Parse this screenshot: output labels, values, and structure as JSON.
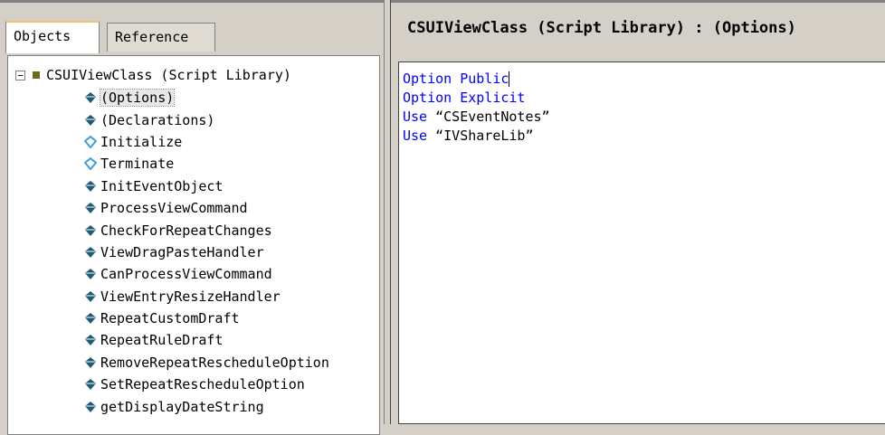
{
  "tabs": {
    "objects": "Objects",
    "reference": "Reference"
  },
  "tree": {
    "root_label": "CSUIViewClass (Script Library)",
    "items": [
      {
        "label": "(Options)",
        "icon": "method-icon"
      },
      {
        "label": "(Declarations)",
        "icon": "method-icon"
      },
      {
        "label": "Initialize",
        "icon": "event-icon"
      },
      {
        "label": "Terminate",
        "icon": "event-icon"
      },
      {
        "label": "InitEventObject",
        "icon": "method-icon"
      },
      {
        "label": "ProcessViewCommand",
        "icon": "method-icon"
      },
      {
        "label": "CheckForRepeatChanges",
        "icon": "method-icon"
      },
      {
        "label": "ViewDragPasteHandler",
        "icon": "method-icon"
      },
      {
        "label": "CanProcessViewCommand",
        "icon": "method-icon"
      },
      {
        "label": "ViewEntryResizeHandler",
        "icon": "method-icon"
      },
      {
        "label": "RepeatCustomDraft",
        "icon": "method-icon"
      },
      {
        "label": "RepeatRuleDraft",
        "icon": "method-icon"
      },
      {
        "label": "RemoveRepeatRescheduleOption",
        "icon": "method-icon"
      },
      {
        "label": "SetRepeatRescheduleOption",
        "icon": "method-icon"
      },
      {
        "label": "getDisplayDateString",
        "icon": "method-icon"
      }
    ]
  },
  "editor": {
    "title": "CSUIViewClass (Script Library) : (Options)",
    "lines": [
      {
        "kw": "Option Public",
        "rest": ""
      },
      {
        "kw": "Option Explicit",
        "rest": ""
      },
      {
        "kw": "Use",
        "rest": " “CSEventNotes”"
      },
      {
        "kw": "Use",
        "rest": " “IVShareLib”"
      }
    ]
  },
  "colors": {
    "keyword": "#0000ff",
    "method_icon": "#1e5a78",
    "event_icon": "#3aa0d8"
  }
}
